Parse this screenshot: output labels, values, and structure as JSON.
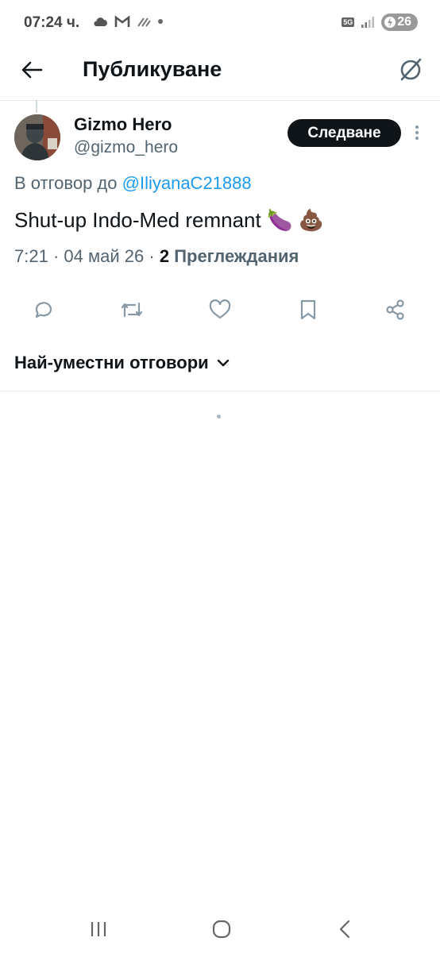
{
  "status_bar": {
    "time": "07:24 ч.",
    "network": "5G",
    "battery": "26"
  },
  "header": {
    "title": "Публикуване"
  },
  "tweet": {
    "author_name": "Gizmo Hero",
    "author_handle": "@gizmo_hero",
    "follow_label": "Следване",
    "reply_prefix": "В отговор до",
    "reply_handle": "@IliyanaC21888",
    "text": "Shut-up Indo-Med remnant 🍆 💩",
    "time": "7:21",
    "separator": "·",
    "date": "04 май 26",
    "views_count": "2",
    "views_label": "Преглеждания"
  },
  "replies": {
    "sort_label": "Най-уместни отговори"
  },
  "colors": {
    "accent_link": "#1d9bf0",
    "text_primary": "#0f1419",
    "text_secondary": "#536471",
    "action_icon": "#8899a6"
  }
}
